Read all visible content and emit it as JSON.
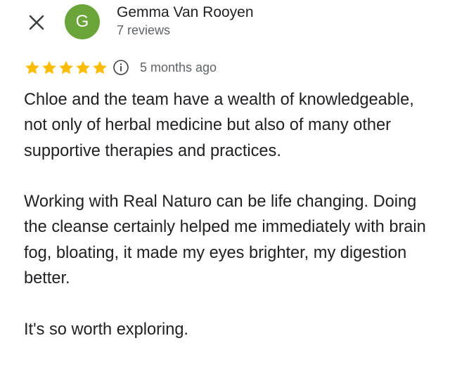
{
  "colors": {
    "avatar_bg": "#6ba539",
    "star": "#fbbc04",
    "icon": "#3c4043"
  },
  "header": {
    "close_icon": "close-icon",
    "avatar_initial": "G",
    "reviewer_name": "Gemma Van Rooyen",
    "review_count": "7 reviews"
  },
  "review": {
    "rating": 5,
    "rating_max": 5,
    "info_icon": "info-icon",
    "date": "5 months ago",
    "paragraphs": [
      "Chloe and the team have a wealth of knowledgeable, not only of herbal medicine but also of many other supportive therapies and practices.",
      "Working with Real Naturo can be life changing. Doing the cleanse certainly helped me immediately with brain fog, bloating, it made my eyes brighter, my digestion better.",
      "It's so worth exploring."
    ]
  }
}
